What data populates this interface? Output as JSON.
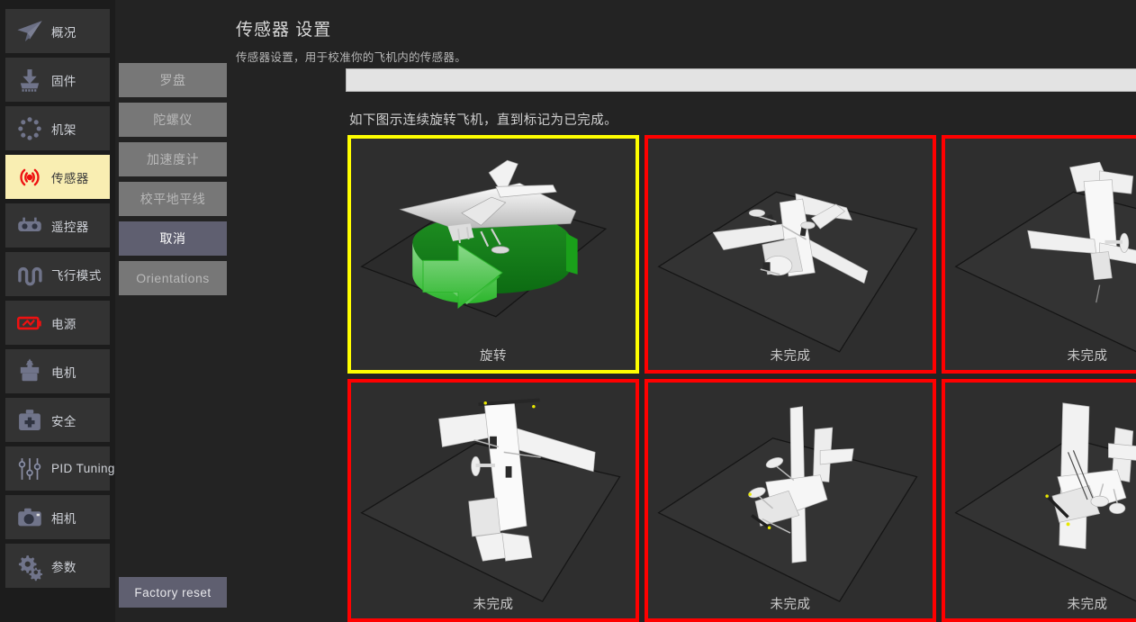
{
  "sidebar": {
    "items": [
      {
        "label": "概况",
        "icon": "paper-plane-icon",
        "active": false
      },
      {
        "label": "固件",
        "icon": "download-chip-icon",
        "active": false
      },
      {
        "label": "机架",
        "icon": "frame-dots-icon",
        "active": false
      },
      {
        "label": "传感器",
        "icon": "sensor-waves-icon",
        "active": true
      },
      {
        "label": "遥控器",
        "icon": "rc-transmitter-icon",
        "active": false
      },
      {
        "label": "飞行模式",
        "icon": "waveform-icon",
        "active": false
      },
      {
        "label": "电源",
        "icon": "battery-icon",
        "active": false
      },
      {
        "label": "电机",
        "icon": "motor-icon",
        "active": false
      },
      {
        "label": "安全",
        "icon": "first-aid-kit-icon",
        "active": false
      },
      {
        "label": "PID Tuning",
        "icon": "sliders-icon",
        "active": false
      },
      {
        "label": "相机",
        "icon": "camera-icon",
        "active": false
      },
      {
        "label": "参数",
        "icon": "gears-icon",
        "active": false
      }
    ]
  },
  "actions": {
    "buttons": [
      {
        "label": "罗盘",
        "state": "disabled"
      },
      {
        "label": "陀螺仪",
        "state": "disabled"
      },
      {
        "label": "加速度计",
        "state": "disabled"
      },
      {
        "label": "校平地平线",
        "state": "disabled"
      },
      {
        "label": "取消",
        "state": "primary"
      },
      {
        "label": "Orientations",
        "state": "disabled"
      }
    ],
    "factory_reset_label": "Factory reset"
  },
  "header": {
    "title": "传感器 设置",
    "subtitle": "传感器设置，用于校准你的飞机内的传感器。"
  },
  "progress": {
    "percent": 0,
    "track_color": "#e3e3e3",
    "fill_color": "#3c8f3c"
  },
  "instruction": "如下图示连续旋转飞机，直到标记为已完成。",
  "colors": {
    "active_nav_bg": "#f9eeb2",
    "sensor_icon_red": "#ee1111",
    "card_pending_border": "#ff0000",
    "card_current_border": "#ffff00",
    "arrow_green": "#1a9a1a",
    "panel_bg": "#232323",
    "sidebar_bg": "#1c1c1c"
  },
  "orientations": {
    "cards": [
      {
        "label": "旋转",
        "status": "current",
        "pose": "level-rotate"
      },
      {
        "label": "未完成",
        "status": "pending",
        "pose": "nose-down"
      },
      {
        "label": "未完成",
        "status": "pending",
        "pose": "nose-up"
      },
      {
        "label": "未完成",
        "status": "pending",
        "pose": "tail-down"
      },
      {
        "label": "未完成",
        "status": "pending",
        "pose": "left-side"
      },
      {
        "label": "未完成",
        "status": "pending",
        "pose": "right-side"
      }
    ]
  }
}
